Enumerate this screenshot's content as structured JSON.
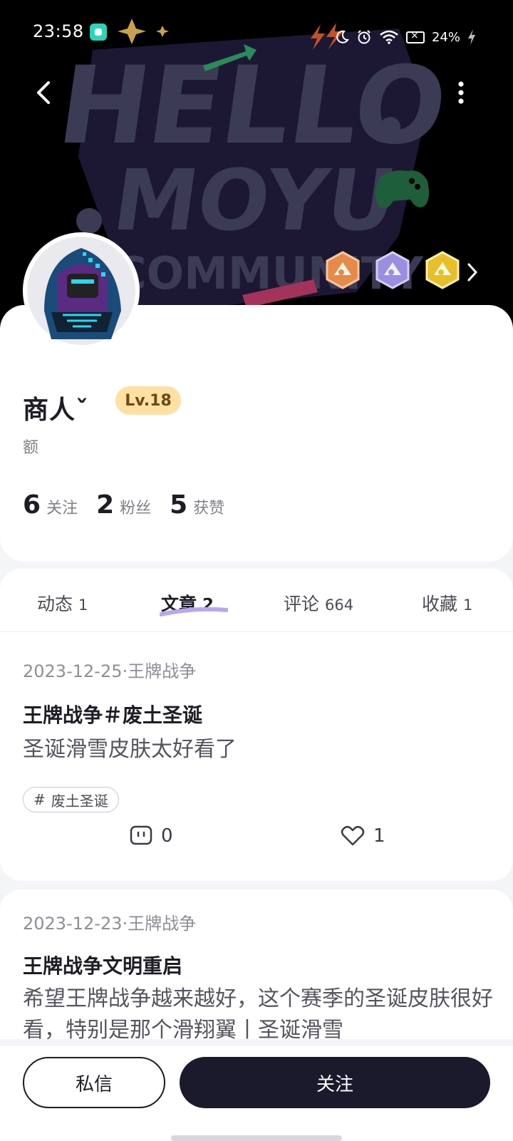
{
  "status_bar": {
    "time": "23:58",
    "battery": "24%",
    "icons": [
      "app-notification-icon",
      "bolt-icon",
      "moon-icon",
      "alarm-icon",
      "wifi-icon",
      "battery-icon",
      "charging-icon"
    ]
  },
  "header": {
    "banner_text_lines": [
      "HELLO.",
      "MOYU",
      "COMMUNITY"
    ],
    "colors": {
      "banner_bg": "#000000",
      "banner_text": "#3b3b55"
    }
  },
  "badges": [
    {
      "name": "bronze-badge",
      "color": "#e68a4a"
    },
    {
      "name": "silver-badge",
      "color": "#9b8de0"
    },
    {
      "name": "gold-badge",
      "color": "#e7bf2b"
    }
  ],
  "profile": {
    "username": "商人ˇ",
    "level": "Lv.18",
    "bio": "额",
    "stats": [
      {
        "value": "6",
        "label": "关注"
      },
      {
        "value": "2",
        "label": "粉丝"
      },
      {
        "value": "5",
        "label": "获赞"
      }
    ]
  },
  "tabs": [
    {
      "label": "动态",
      "count": "1",
      "active": false
    },
    {
      "label": "文章",
      "count": "2",
      "active": true
    },
    {
      "label": "评论",
      "count": "664",
      "active": false
    },
    {
      "label": "收藏",
      "count": "1",
      "active": false
    }
  ],
  "posts": [
    {
      "meta": "2023-12-25·王牌战争",
      "title": "王牌战争＃废土圣诞",
      "body": "圣诞滑雪皮肤太好看了",
      "tag": "废土圣诞",
      "tag_symbol": "#",
      "comments": "0",
      "likes": "1"
    },
    {
      "meta": "2023-12-23·王牌战争",
      "title": "王牌战争文明重启",
      "body": "希望王牌战争越来越好，这个赛季的圣诞皮肤很好看，特别是那个滑翔翼丨圣诞滑雪"
    }
  ],
  "bottom": {
    "message_label": "私信",
    "follow_label": "关注"
  },
  "colors": {
    "accent": "#1a1a2c",
    "level_bg": "#ffe0a3",
    "tab_underline": "#b9a6f3"
  }
}
